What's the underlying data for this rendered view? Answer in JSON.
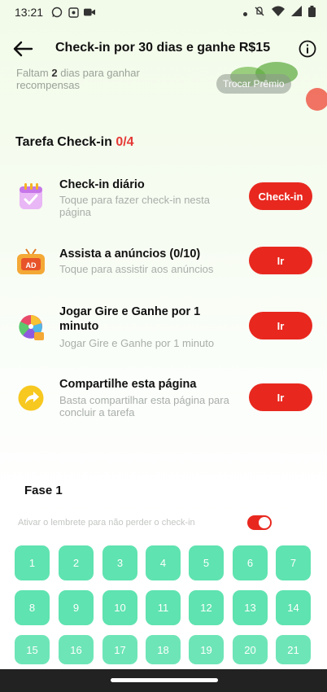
{
  "status_bar": {
    "time": "13:21",
    "icons": [
      "whatsapp-icon",
      "image-icon",
      "video-icon",
      "dot-icon",
      "mute-icon",
      "wifi-icon",
      "signal-icon",
      "battery-icon"
    ]
  },
  "header": {
    "title": "Check-in por 30 dias e ganhe R$15",
    "back_icon": "arrow-left-icon",
    "info_icon": "info-icon"
  },
  "top": {
    "days_left_prefix": "Faltam",
    "days_left_number": "2",
    "days_left_suffix": "dias para ganhar recompensas",
    "trocar_label": "Trocar Prêmio"
  },
  "tasks_section": {
    "title": "Tarefa Check-in",
    "count": "0/4"
  },
  "tasks": [
    {
      "icon": "calendar-icon",
      "name": "Check-in diário",
      "desc": "Toque para fazer check-in nesta página",
      "button": "Check-in"
    },
    {
      "icon": "ad-tv-icon",
      "name": "Assista a anúncios  (0/10)",
      "desc": "Toque para assistir aos anúncios",
      "button": "Ir"
    },
    {
      "icon": "spin-wheel-icon",
      "name": "Jogar Gire e Ganhe por 1 minuto",
      "desc": "Jogar Gire e Ganhe por 1 minuto",
      "button": "Ir"
    },
    {
      "icon": "share-icon",
      "name": "Compartilhe esta página",
      "desc": "Basta compartilhar esta página para concluir a tarefa",
      "button": "Ir"
    }
  ],
  "fase": {
    "title": "Fase 1",
    "reminder": "Ativar o lembrete para não perder o check-in",
    "reminder_on": true
  },
  "days": [
    "1",
    "2",
    "3",
    "4",
    "5",
    "6",
    "7",
    "8",
    "9",
    "10",
    "11",
    "12",
    "13",
    "14",
    "15",
    "16",
    "17",
    "18",
    "19",
    "20",
    "21"
  ],
  "colors": {
    "accent_red": "#e8281f",
    "day_green": "#5fe3b0",
    "background_green": "#f2fbe9"
  }
}
